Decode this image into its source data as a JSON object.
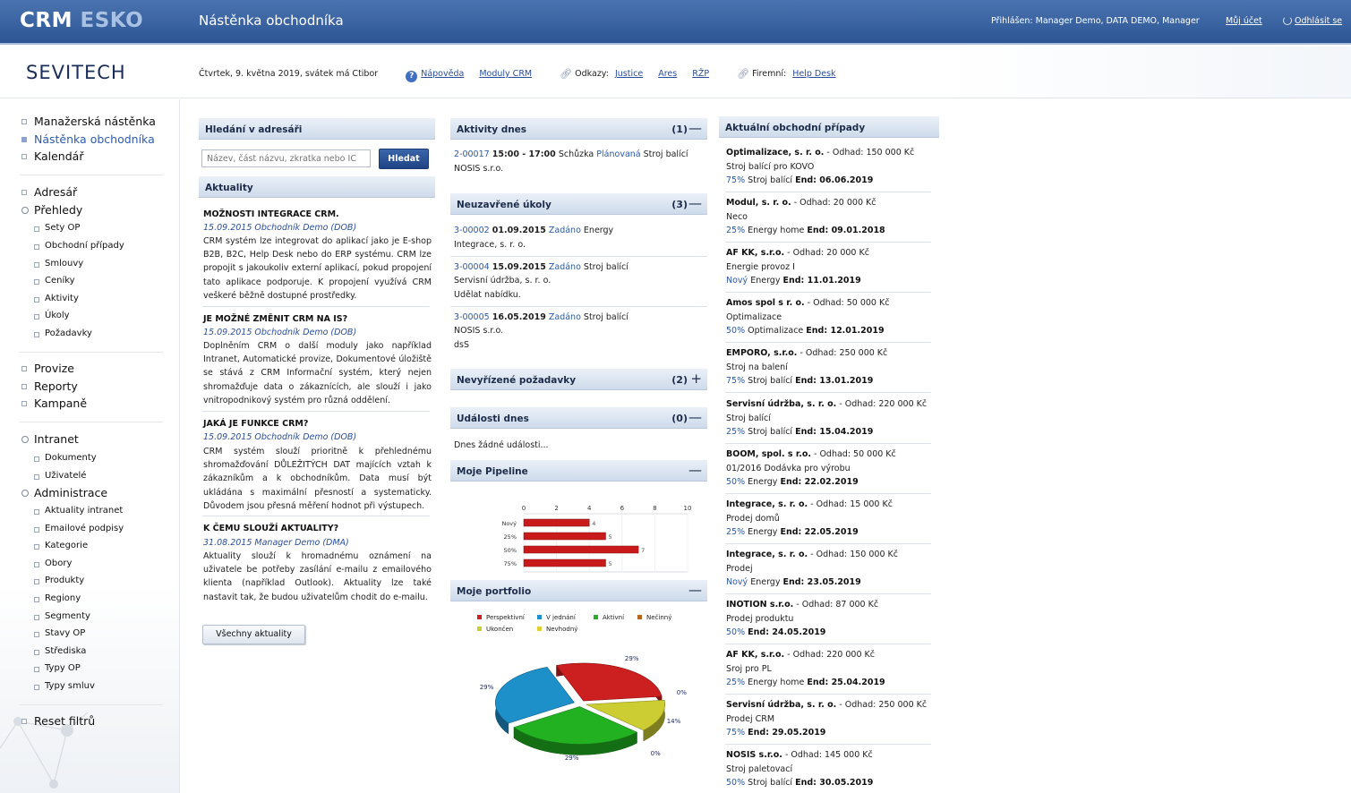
{
  "header": {
    "brand_a": "CRM",
    "brand_b": "ESKO",
    "page_title": "Nástěnka obchodníka",
    "user_info": "Přihlášen: Manager Demo, DATA DEMO, Manager",
    "my_account": "Můj účet",
    "logout": "Odhlásit se"
  },
  "subheader": {
    "logo": "SEVITECH",
    "date": "Čtvrtek, 9. května 2019, svátek má Ctibor",
    "help": "Nápověda",
    "modules": "Moduly CRM",
    "links_label": "Odkazy:",
    "link_1": "Justice",
    "link_2": "Ares",
    "link_3": "RŽP",
    "firm_label": "Firemní:",
    "helpdesk": "Help Desk"
  },
  "sidebar": {
    "g1": [
      "Manažerská nástěnka",
      "Nástěnka obchodníka",
      "Kalendář"
    ],
    "adresar": "Adresář",
    "prehledy": "Přehledy",
    "prehledy_items": [
      "Sety OP",
      "Obchodní případy",
      "Smlouvy",
      "Ceníky",
      "Aktivity",
      "Úkoly",
      "Požadavky"
    ],
    "g3": [
      "Provize",
      "Reporty",
      "Kampaně"
    ],
    "intranet": "Intranet",
    "intranet_items": [
      "Dokumenty",
      "Uživatelé"
    ],
    "administrace": "Administrace",
    "admin_items": [
      "Aktuality intranet",
      "Emailové podpisy",
      "Kategorie",
      "Obory",
      "Produkty",
      "Regiony",
      "Segmenty",
      "Stavy OP",
      "Střediska",
      "Typy OP",
      "Typy smluv"
    ],
    "reset": "Reset filtrů"
  },
  "search": {
    "title": "Hledání v adresáři",
    "placeholder": "Název, část názvu, zkratka nebo IČ",
    "button": "Hledat"
  },
  "news": {
    "title": "Aktuality",
    "items": [
      {
        "title": "MOŽNOSTI INTEGRACE CRM.",
        "meta": "15.09.2015 Obchodník Demo (DOB)",
        "body": "CRM systém lze integrovat do aplikací jako je E-shop B2B, B2C, Help Desk nebo do ERP systému. CRM lze propojit s jakoukoliv externí aplikací, pokud propojení tato aplikace podporuje. K propojení využívá CRM veškeré běžně dostupné prostředky."
      },
      {
        "title": "JE MOŽNÉ ZMĚNIT CRM NA IS?",
        "meta": "15.09.2015 Obchodník Demo (DOB)",
        "body": "Doplněním CRM o další moduly jako například Intranet, Automatické provize, Dokumentové úložiště se stává z CRM Informační systém, který nejen shromažďuje data o zákaznících, ale slouží i jako vnitropodnikový systém pro různá oddělení."
      },
      {
        "title": "JAKÁ JE FUNKCE CRM?",
        "meta": "15.09.2015 Obchodník Demo (DOB)",
        "body": "CRM systém slouží prioritně k přehlednému shromažďování DŮLEŽITÝCH DAT majících vztah k zákazníkům a k obchodníkům. Data musí být ukládána s maximální přesností a systematicky. Důvodem jsou přesná měření hodnot při výstupech."
      },
      {
        "title": "K ČEMU SLOUŽÍ AKTUALITY?",
        "meta": "31.08.2015 Manager Demo (DMA)",
        "body": "Aktuality slouží k hromadnému oznámení na uživatele be potřeby zasílání e-mailu z emailového klienta (například Outlook). Aktuality lze také nastavit tak, že budou uživatelům chodit do e-mailu."
      }
    ],
    "all_button": "Všechny aktuality"
  },
  "activities": {
    "title": "Aktivity dnes",
    "count": "(1)",
    "toggle": "—",
    "item": {
      "id": "2-00017",
      "time": "15:00 - 17:00",
      "type": "Schůzka",
      "status": "Plánovaná",
      "product": "Stroj balící",
      "company": "NOSIS s.r.o."
    }
  },
  "tasks": {
    "title": "Neuzavřené úkoly",
    "count": "(3)",
    "toggle": "—",
    "items": [
      {
        "id": "3-00002",
        "date": "01.09.2015",
        "status": "Zadáno",
        "product": "Energy",
        "company": "Integrace, s. r. o.",
        "note": ""
      },
      {
        "id": "3-00004",
        "date": "15.09.2015",
        "status": "Zadáno",
        "product": "Stroj balící",
        "company": "Servisní údržba, s. r. o.",
        "note": "Udělat nabídku."
      },
      {
        "id": "3-00005",
        "date": "16.05.2019",
        "status": "Zadáno",
        "product": "Stroj balící",
        "company": "NOSIS s.r.o.",
        "note": "dsS"
      }
    ]
  },
  "requests": {
    "title": "Nevyřízené požadavky",
    "count": "(2)",
    "toggle": "+"
  },
  "events": {
    "title": "Události dnes",
    "count": "(0)",
    "toggle": "—",
    "empty": "Dnes žádné události..."
  },
  "pipeline": {
    "title": "Moje Pipeline",
    "toggle": "—"
  },
  "portfolio": {
    "title": "Moje portfolio",
    "toggle": "—"
  },
  "chart_data": [
    {
      "type": "bar",
      "orientation": "horizontal",
      "title": "",
      "categories": [
        "Nový",
        "25%",
        "50%",
        "75%"
      ],
      "values": [
        4,
        5,
        7,
        5
      ],
      "xlim": [
        0,
        10
      ],
      "ticks": [
        "0",
        "2",
        "4",
        "6",
        "8",
        "10"
      ],
      "color": "#c81a1a"
    },
    {
      "type": "pie",
      "title": "",
      "legend_position": "top",
      "slices": [
        {
          "label": "Perspektivní",
          "percent": 29,
          "pct_label": "29%",
          "color": "#cc1f1f"
        },
        {
          "label": "Nečinný",
          "percent": 0,
          "pct_label": "0%",
          "color": "#b5651d"
        },
        {
          "label": "Nevhodný",
          "percent": 14,
          "pct_label": "14%",
          "color": "#cccc33"
        },
        {
          "label": "Ukončen",
          "percent": 0,
          "pct_label": "0%",
          "color": "#cccc33"
        },
        {
          "label": "Aktivní",
          "percent": 29,
          "pct_label": "29%",
          "color": "#21b121"
        },
        {
          "label": "V jednání",
          "percent": 29,
          "pct_label": "29%",
          "color": "#1e90c9"
        }
      ],
      "legend": [
        {
          "label": "Perspektivní",
          "color": "#cc1f1f"
        },
        {
          "label": "V jednání",
          "color": "#1e90c9"
        },
        {
          "label": "Aktivní",
          "color": "#21b121"
        },
        {
          "label": "Nečinný",
          "color": "#b5651d"
        },
        {
          "label": "Ukončen",
          "color": "#cccc33"
        },
        {
          "label": "Nevhodný",
          "color": "#e0d030"
        }
      ]
    }
  ],
  "cases": {
    "title": "Aktuální obchodní případy",
    "items": [
      {
        "company": "Optimalizace, s. r. o.",
        "estimate": "- Odhad: 150 000 Kč",
        "desc": "Stroj balící pro KOVO",
        "status": "75%",
        "product": "Stroj balící",
        "end": "End: 06.06.2019"
      },
      {
        "company": "Modul, s. r. o.",
        "estimate": "- Odhad: 20 000 Kč",
        "desc": "Neco",
        "status": "25%",
        "product": "Energy home",
        "end": "End: 09.01.2018"
      },
      {
        "company": "AF KK, s.r.o.",
        "estimate": "- Odhad: 20 000 Kč",
        "desc": "Energie provoz I",
        "status": "Nový",
        "product": "Energy",
        "end": "End: 11.01.2019"
      },
      {
        "company": "Amos spol s r. o.",
        "estimate": "- Odhad: 50 000 Kč",
        "desc": "Optimalizace",
        "status": "50%",
        "product": "Optimalizace",
        "end": "End: 12.01.2019"
      },
      {
        "company": "EMPORO, s.r.o.",
        "estimate": "- Odhad: 250 000 Kč",
        "desc": "Stroj na balení",
        "status": "75%",
        "product": "Stroj balící",
        "end": "End: 13.01.2019"
      },
      {
        "company": "Servisní údržba, s. r. o.",
        "estimate": "- Odhad: 220 000 Kč",
        "desc": "Stroj balící",
        "status": "25%",
        "product": "Stroj balící",
        "end": "End: 15.04.2019"
      },
      {
        "company": "BOOM, spol. s r.o.",
        "estimate": "- Odhad: 50 000 Kč",
        "desc": "01/2016 Dodávka pro výrobu",
        "status": "50%",
        "product": "Energy",
        "end": "End: 22.02.2019"
      },
      {
        "company": "Integrace, s. r. o.",
        "estimate": "- Odhad: 15 000 Kč",
        "desc": "Prodej domů",
        "status": "25%",
        "product": "Energy",
        "end": "End: 22.05.2019"
      },
      {
        "company": "Integrace, s. r. o.",
        "estimate": "- Odhad: 150 000 Kč",
        "desc": "Prodej",
        "status": "Nový",
        "product": "Energy",
        "end": "End: 23.05.2019"
      },
      {
        "company": "INOTION s.r.o.",
        "estimate": "- Odhad: 87 000 Kč",
        "desc": "Prodej produktu",
        "status": "50%",
        "product": "",
        "end": "End: 24.05.2019"
      },
      {
        "company": "AF KK, s.r.o.",
        "estimate": "- Odhad: 220 000 Kč",
        "desc": "Sroj pro PL",
        "status": "25%",
        "product": "Energy home",
        "end": "End: 25.04.2019"
      },
      {
        "company": "Servisní údržba, s. r. o.",
        "estimate": "- Odhad: 250 000 Kč",
        "desc": "Prodej CRM",
        "status": "75%",
        "product": "",
        "end": "End: 29.05.2019"
      },
      {
        "company": "NOSIS s.r.o.",
        "estimate": "- Odhad: 145 000 Kč",
        "desc": "Stroj paletovací",
        "status": "50%",
        "product": "Stroj balící",
        "end": "End: 30.05.2019"
      }
    ]
  }
}
